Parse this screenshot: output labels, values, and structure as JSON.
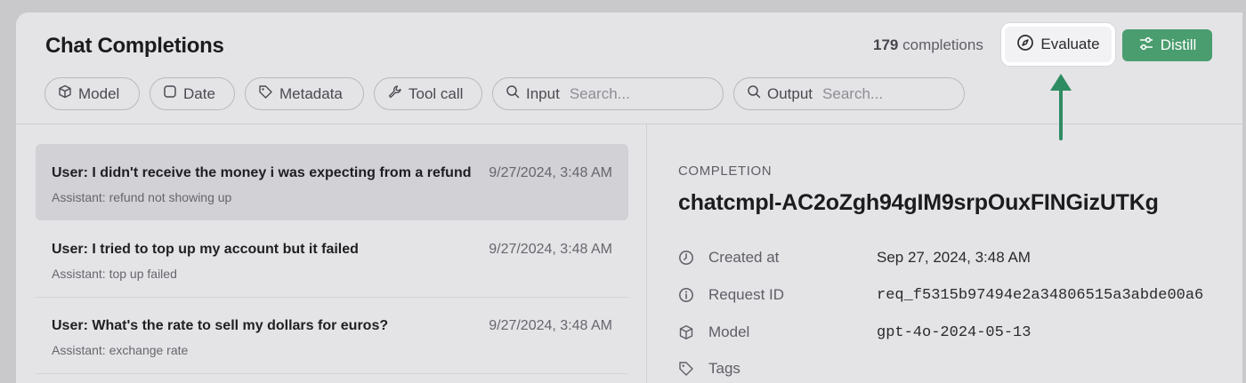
{
  "header": {
    "title": "Chat Completions",
    "count_number": "179",
    "count_label": "completions",
    "evaluate_label": "Evaluate",
    "distill_label": "Distill"
  },
  "filters": [
    {
      "label": "Model",
      "icon": "cube-icon"
    },
    {
      "label": "Date",
      "icon": "calendar-icon"
    },
    {
      "label": "Metadata",
      "icon": "tag-icon"
    },
    {
      "label": "Tool call",
      "icon": "wrench-icon"
    },
    {
      "label": "Input",
      "placeholder": "Search...",
      "icon": "search-icon"
    },
    {
      "label": "Output",
      "placeholder": "Search...",
      "icon": "search-icon"
    }
  ],
  "completions": [
    {
      "title": "User: I didn't receive the money i was expecting from a refund",
      "subtitle": "Assistant: refund not showing up",
      "time": "9/27/2024, 3:48 AM",
      "selected": true
    },
    {
      "title": "User: I tried to top up my account but it failed",
      "subtitle": "Assistant: top up failed",
      "time": "9/27/2024, 3:48 AM",
      "selected": false
    },
    {
      "title": "User: What's the rate to sell my dollars for euros?",
      "subtitle": "Assistant: exchange rate",
      "time": "9/27/2024, 3:48 AM",
      "selected": false
    }
  ],
  "detail": {
    "section_label": "COMPLETION",
    "id": "chatcmpl-AC2oZgh94gIM9srpOuxFINGizUTKg",
    "fields": [
      {
        "name": "Created at",
        "value": "Sep 27, 2024, 3:48 AM",
        "icon": "clock-icon"
      },
      {
        "name": "Request ID",
        "value": "req_f5315b97494e2a34806515a3abde00a6",
        "icon": "info-icon"
      },
      {
        "name": "Model",
        "value": "gpt-4o-2024-05-13",
        "icon": "cube-icon"
      },
      {
        "name": "Tags",
        "value": "",
        "icon": "tag-icon"
      }
    ]
  },
  "colors": {
    "accent_green": "#4a9d6f",
    "arrow_green": "#2e8c62",
    "background": "#e4e4e7"
  }
}
